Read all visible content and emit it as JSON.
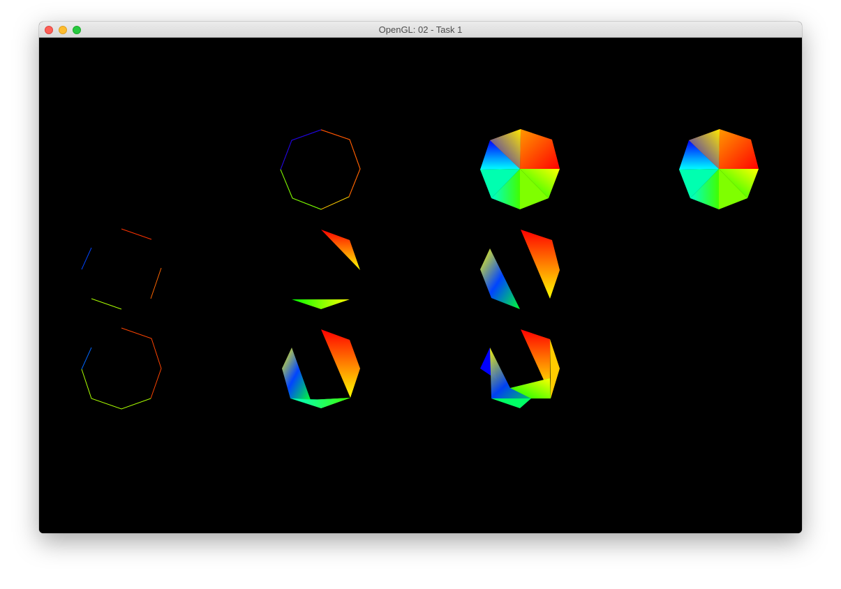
{
  "window": {
    "title": "OpenGL: 02 - Task 1"
  },
  "traffic_lights": {
    "close": "#fe5f57",
    "minimize": "#febc2e",
    "zoom": "#28c840"
  },
  "canvas": {
    "background": "#000000"
  },
  "colors": {
    "red": "#ff0000",
    "orange": "#ff8000",
    "yellow": "#ffff00",
    "green": "#00ff00",
    "cyan": "#00ffff",
    "blue": "#0000ff"
  }
}
